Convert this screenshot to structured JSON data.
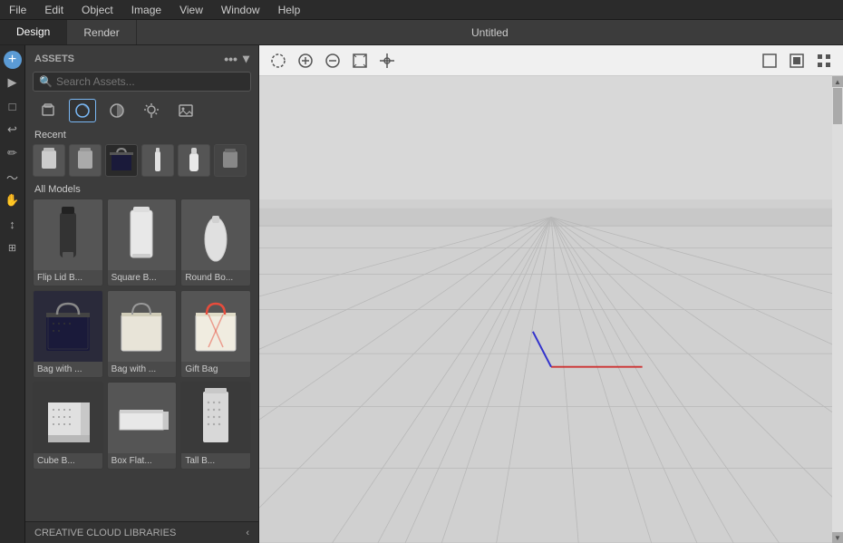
{
  "menubar": {
    "items": [
      "File",
      "Edit",
      "Object",
      "Image",
      "View",
      "Window",
      "Help"
    ]
  },
  "tabbar": {
    "tabs": [
      "Design",
      "Render"
    ],
    "active": "Design",
    "title": "Untitled"
  },
  "assets": {
    "header": "ASSETS",
    "search_placeholder": "Search Assets...",
    "categories": [
      {
        "name": "objects-icon",
        "symbol": "📦"
      },
      {
        "name": "shapes-icon",
        "symbol": "⬡"
      },
      {
        "name": "materials-icon",
        "symbol": "◑"
      },
      {
        "name": "lights-icon",
        "symbol": "✦"
      },
      {
        "name": "images-icon",
        "symbol": "🖼"
      }
    ],
    "active_category": 1,
    "recent_label": "Recent",
    "recent_items": [
      {
        "name": "recent-cup",
        "type": "cup"
      },
      {
        "name": "recent-cup2",
        "type": "cup-dark"
      },
      {
        "name": "recent-bag-dark",
        "type": "bag-dark"
      },
      {
        "name": "recent-bottle",
        "type": "bottle"
      },
      {
        "name": "recent-bottle2",
        "type": "bottle-tall"
      },
      {
        "name": "recent-cup3",
        "type": "cup-dark2"
      }
    ],
    "all_models_label": "All Models",
    "models": [
      {
        "id": "flip-lid-b",
        "label": "Flip Lid B...",
        "type": "bottle-dark"
      },
      {
        "id": "square-b",
        "label": "Square B...",
        "type": "bottle-white"
      },
      {
        "id": "round-bo",
        "label": "Round Bo...",
        "type": "bottle-round"
      },
      {
        "id": "bag-dark",
        "label": "Bag with ...",
        "type": "bag-dark"
      },
      {
        "id": "bag-light",
        "label": "Bag with ...",
        "type": "bag-light"
      },
      {
        "id": "gift-bag",
        "label": "Gift Bag",
        "type": "gift-bag"
      },
      {
        "id": "cube1",
        "label": "Cube B...",
        "type": "cube"
      },
      {
        "id": "flat-box",
        "label": "Box Flat...",
        "type": "flat-box"
      },
      {
        "id": "tall-b",
        "label": "Tall B...",
        "type": "tall-dotted"
      }
    ]
  },
  "cloud": {
    "label": "CREATIVE CLOUD LIBRARIES"
  },
  "viewport": {
    "tools": [
      {
        "name": "select-circle-icon",
        "symbol": "○"
      },
      {
        "name": "add-icon",
        "symbol": "⊕"
      },
      {
        "name": "subtract-icon",
        "symbol": "⊖"
      },
      {
        "name": "fit-icon",
        "symbol": "⤢"
      },
      {
        "name": "snap-icon",
        "symbol": "✛"
      }
    ],
    "tools_right": [
      {
        "name": "frame-icon",
        "symbol": "⬜"
      },
      {
        "name": "render-icon",
        "symbol": "▣"
      },
      {
        "name": "grid-icon",
        "symbol": "⊞"
      }
    ]
  }
}
